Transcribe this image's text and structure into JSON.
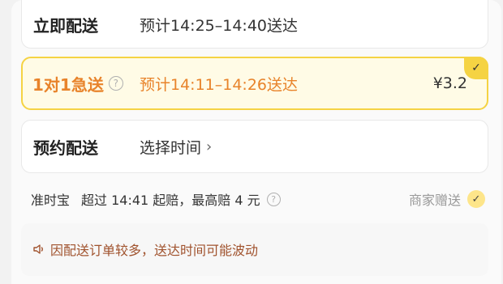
{
  "options": [
    {
      "title": "立即配送",
      "desc": "预计14:25–14:40送达"
    },
    {
      "title": "1对1急送",
      "desc": "预计14:11–14:26送达",
      "price": "¥3.2",
      "selected": true
    },
    {
      "title": "预约配送",
      "desc": "选择时间"
    }
  ],
  "help_glyph": "?",
  "chevron": "›",
  "check_glyph": "✓",
  "guarantee": {
    "label": "准时宝",
    "desc": "超过 14:41 起赔，最高赔 4 元",
    "right_label": "商家赠送"
  },
  "notice": "因配送订单较多，送达时间可能波动",
  "colors": {
    "accent": "#f5d343",
    "accent_text": "#e8832a",
    "notice_text": "#a0522d"
  }
}
